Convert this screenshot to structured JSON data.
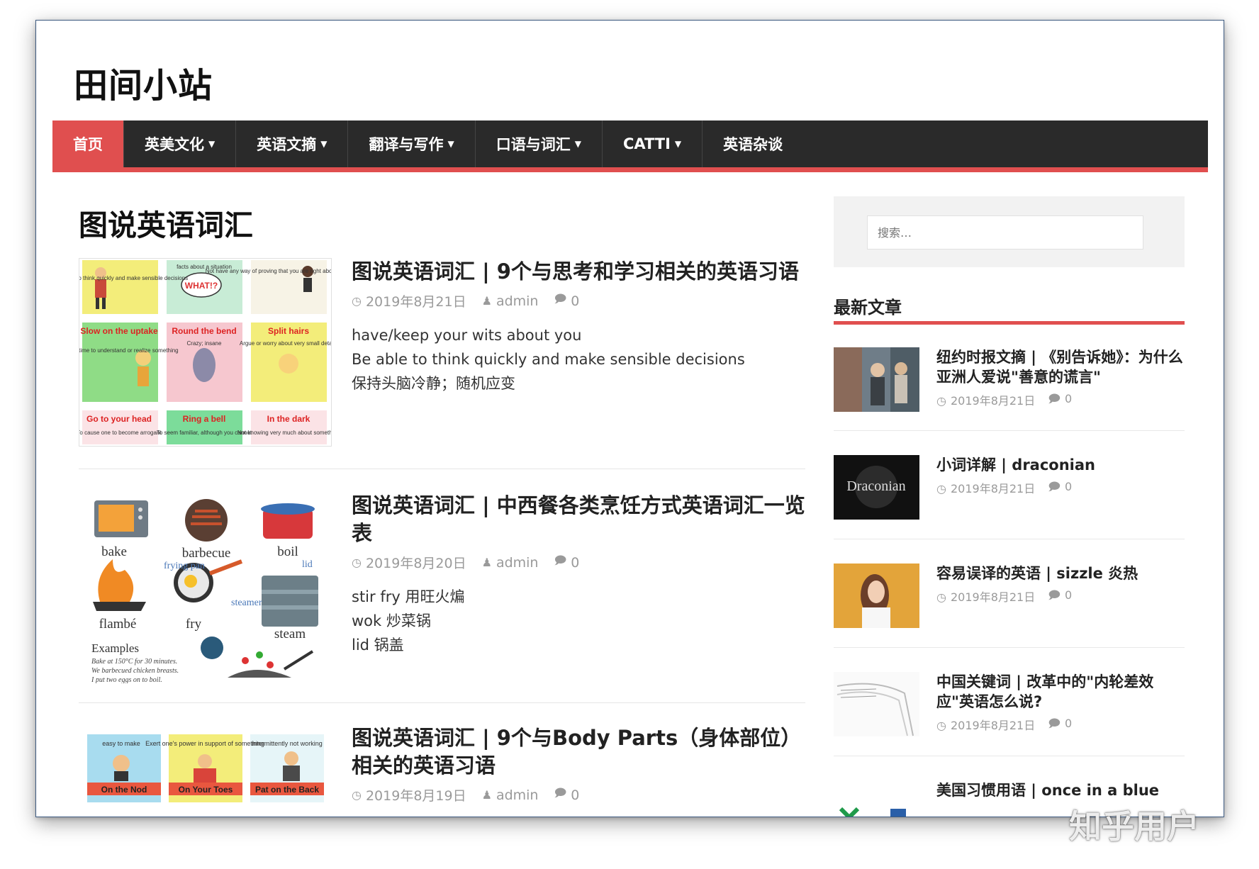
{
  "site": {
    "title": "田间小站"
  },
  "nav": {
    "items": [
      {
        "label": "首页",
        "dropdown": false,
        "active": true
      },
      {
        "label": "英美文化",
        "dropdown": true
      },
      {
        "label": "英语文摘",
        "dropdown": true
      },
      {
        "label": "翻译与写作",
        "dropdown": true
      },
      {
        "label": "口语与词汇",
        "dropdown": true
      },
      {
        "label": "CATTI",
        "dropdown": true
      },
      {
        "label": "英语杂谈",
        "dropdown": false
      }
    ],
    "accent_color": "#e04f4f",
    "background_color": "#2a2a2a"
  },
  "main": {
    "page_title": "图说英语词汇",
    "posts": [
      {
        "title": "图说英语词汇 | 9个与思考和学习相关的英语习语",
        "date": "2019年8月21日",
        "author": "admin",
        "comments": "0",
        "excerpt": [
          "have/keep your wits about you",
          "Be able to think quickly and make sensible decisions",
          "保持头脑冷静；随机应变"
        ],
        "thumb": {
          "cells": [
            {
              "title": "",
              "desc": "Be able to think quickly and make sensible decisions"
            },
            {
              "title": "",
              "desc": "facts about a situation"
            },
            {
              "title": "",
              "desc": "Not have any way of proving that you are right about something"
            },
            {
              "title": "Slow on the uptake",
              "desc": "Taking a very long time to understand or realize something"
            },
            {
              "title": "Round the bend",
              "desc": "Crazy; insane"
            },
            {
              "title": "Split hairs",
              "desc": "Argue or worry about very small details"
            },
            {
              "title": "Go to your head",
              "desc": "To cause one to become arrogant"
            },
            {
              "title": "Ring a bell",
              "desc": "To seem familiar, although you cannot"
            },
            {
              "title": "In the dark",
              "desc": "Not knowing very much about something"
            }
          ],
          "bubble": "WHAT!?"
        }
      },
      {
        "title": "图说英语词汇 | 中西餐各类烹饪方式英语词汇一览表",
        "date": "2019年8月20日",
        "author": "admin",
        "comments": "0",
        "excerpt": [
          "stir fry 用旺火煸",
          "wok 炒菜锅",
          "lid 锅盖"
        ],
        "thumb": {
          "words": [
            "bake",
            "barbecue",
            "boil",
            "frying pan",
            "lid",
            "steamer",
            "flambé",
            "fry",
            "steam"
          ],
          "examples_title": "Examples",
          "examples": [
            "Bake at 150°C for 30 minutes.",
            "We barbecued chicken breasts.",
            "I put two eggs on to boil."
          ]
        }
      },
      {
        "title": "图说英语词汇 | 9个与Body Parts（身体部位）相关的英语习语",
        "date": "2019年8月19日",
        "author": "admin",
        "comments": "0",
        "excerpt": [],
        "thumb": {
          "cells": [
            {
              "title": "On the Nod",
              "desc": "easy to make"
            },
            {
              "title": "On Your Toes",
              "desc": "Exert one's power in support of something"
            },
            {
              "title": "Pat on the Back",
              "desc": "intermittently not working"
            }
          ]
        }
      }
    ]
  },
  "sidebar": {
    "search": {
      "placeholder": "搜索…"
    },
    "recent_title": "最新文章",
    "recent_posts": [
      {
        "title": "纽约时报文摘 | 《别告诉她》：为什么亚洲人爱说\"善意的谎言\"",
        "date": "2019年8月21日",
        "comments": "0"
      },
      {
        "title": "小词详解 | draconian",
        "date": "2019年8月21日",
        "comments": "0",
        "thumb_text": "Draconian"
      },
      {
        "title": "容易误译的英语 | sizzle 炎热",
        "date": "2019年8月21日",
        "comments": "0"
      },
      {
        "title": "中国关键词 | 改革中的\"内轮差效应\"英语怎么说?",
        "date": "2019年8月21日",
        "comments": "0"
      },
      {
        "title": "美国习惯用语 | once in a blue",
        "date": "",
        "comments": ""
      }
    ]
  },
  "watermark": "知乎用户"
}
